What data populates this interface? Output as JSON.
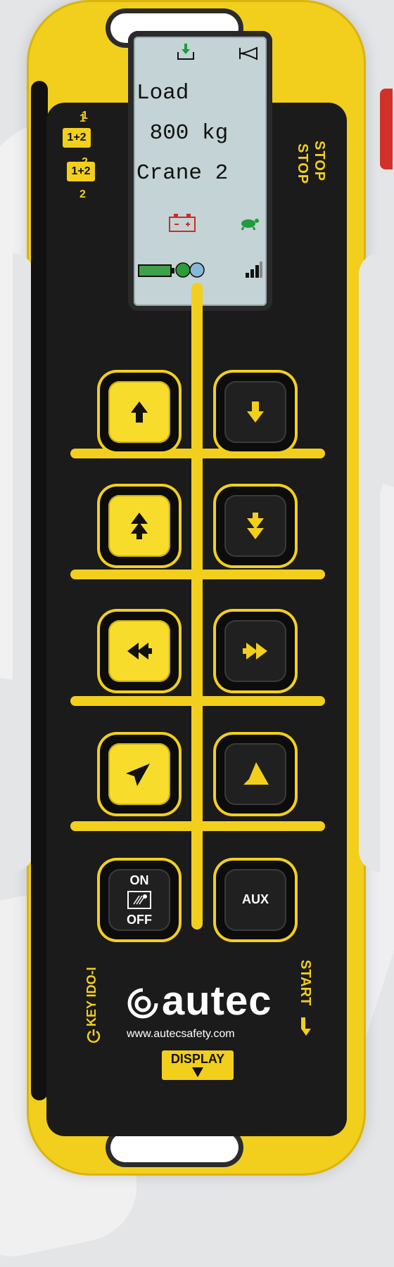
{
  "colors": {
    "body_yellow": "#f2cf1c",
    "panel_black": "#1b1b1b",
    "lcd_bg": "#c4d3d5",
    "stop_red": "#d2312a"
  },
  "channel_selector": {
    "option_1": "1",
    "option_1_2": "1+2",
    "option_2": "2"
  },
  "labels": {
    "stop": "STOP",
    "start": "START",
    "key": "KEY IDO-I",
    "display": "DISPLAY"
  },
  "lcd": {
    "icons": [
      "load-down-icon",
      "horn-icon",
      "battery-warning-icon",
      "turtle-speed-icon",
      "battery-level-icon",
      "status-led-icon",
      "signal-strength-icon"
    ],
    "line1": "Load",
    "line2": " 800 kg",
    "line3": "Crane 2"
  },
  "buttons": [
    {
      "id": "up",
      "icon": "arrow-up-icon",
      "style": "yellow"
    },
    {
      "id": "down",
      "icon": "arrow-down-icon",
      "style": "black"
    },
    {
      "id": "fast-up",
      "icon": "double-arrow-up-icon",
      "style": "yellow"
    },
    {
      "id": "fast-down",
      "icon": "double-arrow-down-icon",
      "style": "black"
    },
    {
      "id": "left",
      "icon": "double-arrow-left-icon",
      "style": "yellow"
    },
    {
      "id": "right",
      "icon": "double-arrow-right-icon",
      "style": "black"
    },
    {
      "id": "rotate-left",
      "icon": "diagonal-arrow-left-icon",
      "style": "yellow"
    },
    {
      "id": "rotate-right",
      "icon": "diagonal-arrow-right-icon",
      "style": "black"
    }
  ],
  "on_off_button": {
    "on": "ON",
    "off": "OFF"
  },
  "aux_button": {
    "label": "AUX"
  },
  "brand": {
    "name": "autec",
    "url": "www.autecsafety.com"
  }
}
